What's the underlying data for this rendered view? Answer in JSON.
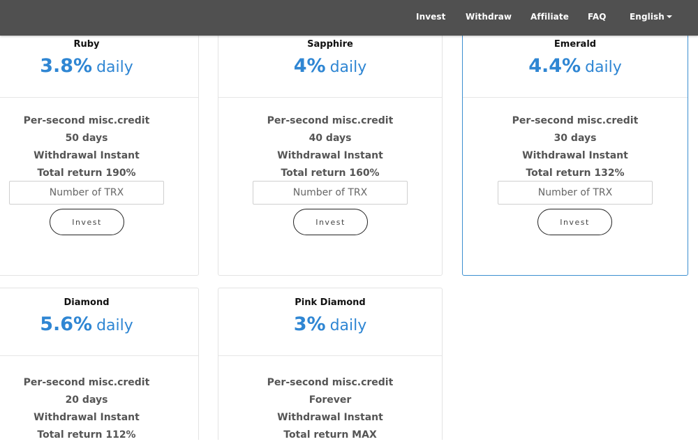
{
  "nav": {
    "items": [
      "Invest",
      "Withdraw",
      "Affiliate",
      "FAQ"
    ],
    "language": "English"
  },
  "colors": {
    "navbar_bg": "#505050",
    "accent": "#2f86d3",
    "active_border": "#3c8fd0"
  },
  "plans": [
    {
      "name": "Ruby",
      "rate": "3.8%",
      "unit": "daily",
      "features": [
        "Per-second misc.credit",
        "50 days",
        "Withdrawal Instant",
        "Total return 190%"
      ],
      "input_placeholder": "Number of TRX",
      "button_label": "Invest",
      "selected": false
    },
    {
      "name": "Sapphire",
      "rate": "4%",
      "unit": "daily",
      "features": [
        "Per-second misc.credit",
        "40 days",
        "Withdrawal Instant",
        "Total return 160%"
      ],
      "input_placeholder": "Number of TRX",
      "button_label": "Invest",
      "selected": false
    },
    {
      "name": "Emerald",
      "rate": "4.4%",
      "unit": "daily",
      "features": [
        "Per-second misc.credit",
        "30 days",
        "Withdrawal Instant",
        "Total return 132%"
      ],
      "input_placeholder": "Number of TRX",
      "button_label": "Invest",
      "selected": true
    },
    {
      "name": "Diamond",
      "rate": "5.6%",
      "unit": "daily",
      "features": [
        "Per-second misc.credit",
        "20 days",
        "Withdrawal Instant",
        "Total return 112%"
      ],
      "selected": false
    },
    {
      "name": "Pink Diamond",
      "rate": "3%",
      "unit": "daily",
      "features": [
        "Per-second misc.credit",
        "Forever",
        "Withdrawal Instant",
        "Total return MAX"
      ],
      "selected": false
    }
  ]
}
